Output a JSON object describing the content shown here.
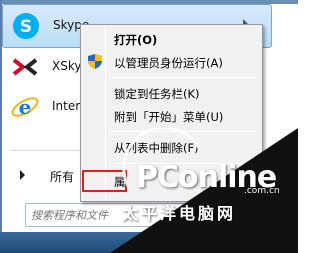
{
  "start_menu": {
    "programs": [
      {
        "name": "Skype",
        "icon": "skype-icon"
      },
      {
        "name": "XSky",
        "icon": "xsky-icon"
      },
      {
        "name": "Inter",
        "icon": "internet-explorer-icon"
      }
    ],
    "all_programs_label": "所有",
    "search_placeholder": "搜索程序和文件"
  },
  "context_menu": {
    "items": [
      {
        "label": "打开(O)",
        "bold": true
      },
      {
        "label": "以管理员身份运行(A)",
        "icon": "uac-shield-icon"
      },
      {
        "label": "锁定到任务栏(K)"
      },
      {
        "label": "附到「开始」菜单(U)"
      },
      {
        "label": "从列表中删除(F)"
      },
      {
        "label": "属"
      }
    ]
  },
  "watermark": {
    "brand": "PConline",
    "chinese": "太平洋电脑网",
    "domain": ".com.cn"
  },
  "colors": {
    "highlight_border": "#e0201a",
    "skype_blue": "#00aff0"
  }
}
